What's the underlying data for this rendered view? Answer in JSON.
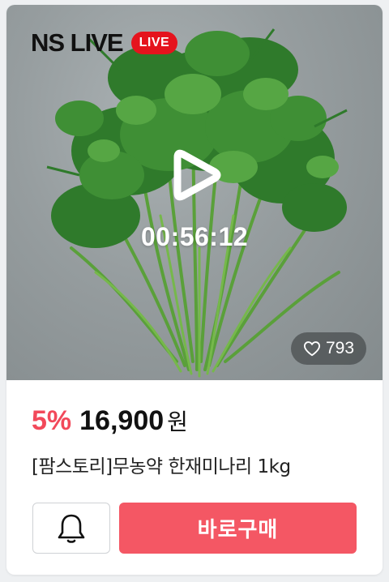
{
  "card": {
    "brand": "NS LIVE",
    "live_badge": "LIVE",
    "timer": "00:56:12",
    "likes": "793",
    "discount": "5%",
    "price": "16,900",
    "currency": "원",
    "product_name": "[팜스토리]무농약 한재미나리 1kg",
    "buy_label": "바로구매"
  },
  "icons": {
    "play": "play-icon",
    "heart": "heart-icon",
    "bell": "bell-icon"
  },
  "colors": {
    "live_badge": "#e5131d",
    "discount": "#f2495a",
    "buy_button": "#f45764"
  }
}
